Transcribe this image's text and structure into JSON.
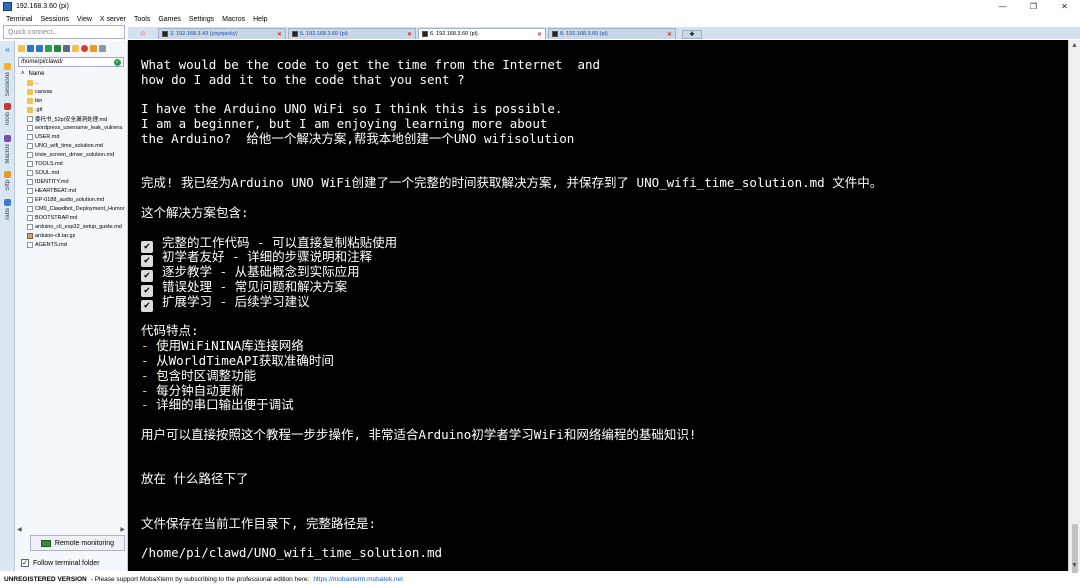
{
  "window": {
    "title": "192.168.3.60 (pi)",
    "controls": [
      "—",
      "❐",
      "✕"
    ]
  },
  "menu": [
    "Terminal",
    "Sessions",
    "View",
    "X server",
    "Tools",
    "Games",
    "Settings",
    "Macros",
    "Help"
  ],
  "quick_connect": {
    "placeholder": "Quick connect..."
  },
  "rail_tabs": [
    "Sessions",
    "Tools",
    "Macros",
    "Sftp",
    "Tabs"
  ],
  "sidebar": {
    "path": "/home/pi/clawd/",
    "column_header": "Name",
    "files": [
      {
        "name": "..",
        "type": "folder"
      },
      {
        "name": "canvas",
        "type": "folder"
      },
      {
        "name": "bin",
        "type": "folder"
      },
      {
        "name": ".git",
        "type": "folder"
      },
      {
        "name": "委托书_52pi安全漏洞处理.md",
        "type": "doc"
      },
      {
        "name": "wordpress_username_leak_vulnera",
        "type": "doc"
      },
      {
        "name": "USER.md",
        "type": "doc"
      },
      {
        "name": "UNO_wifi_time_solution.md",
        "type": "doc"
      },
      {
        "name": "trixie_screen_driver_solution.md",
        "type": "doc"
      },
      {
        "name": "TOOLS.md",
        "type": "doc"
      },
      {
        "name": "SOUL.md",
        "type": "doc"
      },
      {
        "name": "IDENTITY.md",
        "type": "doc"
      },
      {
        "name": "HEARTBEAT.md",
        "type": "doc"
      },
      {
        "name": "EP-0188_audio_solution.md",
        "type": "doc"
      },
      {
        "name": "CM0_Clawdbot_Deployment_Humor",
        "type": "doc"
      },
      {
        "name": "BOOTSTRAP.md",
        "type": "doc"
      },
      {
        "name": "arduino_cli_esp32_setup_guide.md",
        "type": "doc"
      },
      {
        "name": "arduino-cli.tar.gz",
        "type": "archive"
      },
      {
        "name": "AGENTS.md",
        "type": "doc"
      }
    ],
    "remote_monitoring": "Remote monitoring",
    "follow_folder": "Follow terminal folder"
  },
  "tabs": [
    {
      "label": "3. 192.168.3.43 (yoyojacky)",
      "active": false
    },
    {
      "label": "5. 192.168.3.60 (pi)",
      "active": false
    },
    {
      "label": "6. 192.168.3.60 (pi)",
      "active": true
    },
    {
      "label": "8. 192.168.3.60 (pi)",
      "active": false
    }
  ],
  "terminal": {
    "q1": "What would be the code to get the time from the Internet  and",
    "q2": "how do I add it to the code that you sent ?",
    "q3": "I have the Arduino UNO WiFi so I think this is possible.",
    "q4": "I am a beginner, but I am enjoying learning more about",
    "q5": "the Arduino?  给他一个解决方案,帮我本地创建一个UNO wifisolution",
    "done": "完成! 我已经为Arduino UNO WiFi创建了一个完整的时间获取解决方案, 并保存到了 UNO_wifi_time_solution.md 文件中。",
    "includes": "这个解决方案包含:",
    "checks": [
      "完整的工作代码 - 可以直接复制粘贴使用",
      "初学者友好 - 详细的步骤说明和注释",
      "逐步教学 - 从基础概念到实际应用",
      "错误处理 - 常见问题和解决方案",
      "扩展学习 - 后续学习建议"
    ],
    "check_mark": "✔",
    "features_title": "代码特点:",
    "bullet": "-",
    "features": [
      "使用WiFiNINA库连接网络",
      "从WorldTimeAPI获取准确时间",
      "包含时区调整功能",
      "每分钟自动更新",
      "详细的串口输出便于调试"
    ],
    "summary": "用户可以直接按照这个教程一步步操作, 非常适合Arduino初学者学习WiFi和网络编程的基础知识!",
    "ask_path": "放在 什么路径下了",
    "answer": "文件保存在当前工作目录下, 完整路径是:",
    "path": "/home/pi/clawd/UNO_wifi_time_solution.md"
  },
  "status": {
    "unregistered": "UNREGISTERED VERSION",
    "message": "-  Please support MobaXterm by subscribing to the professional edition here:",
    "link": "https://mobaxterm.mobatek.net"
  },
  "colors": {
    "accent": "#1e4c9a",
    "terminal_bg": "#000000",
    "bullet": "#f1d63b"
  }
}
